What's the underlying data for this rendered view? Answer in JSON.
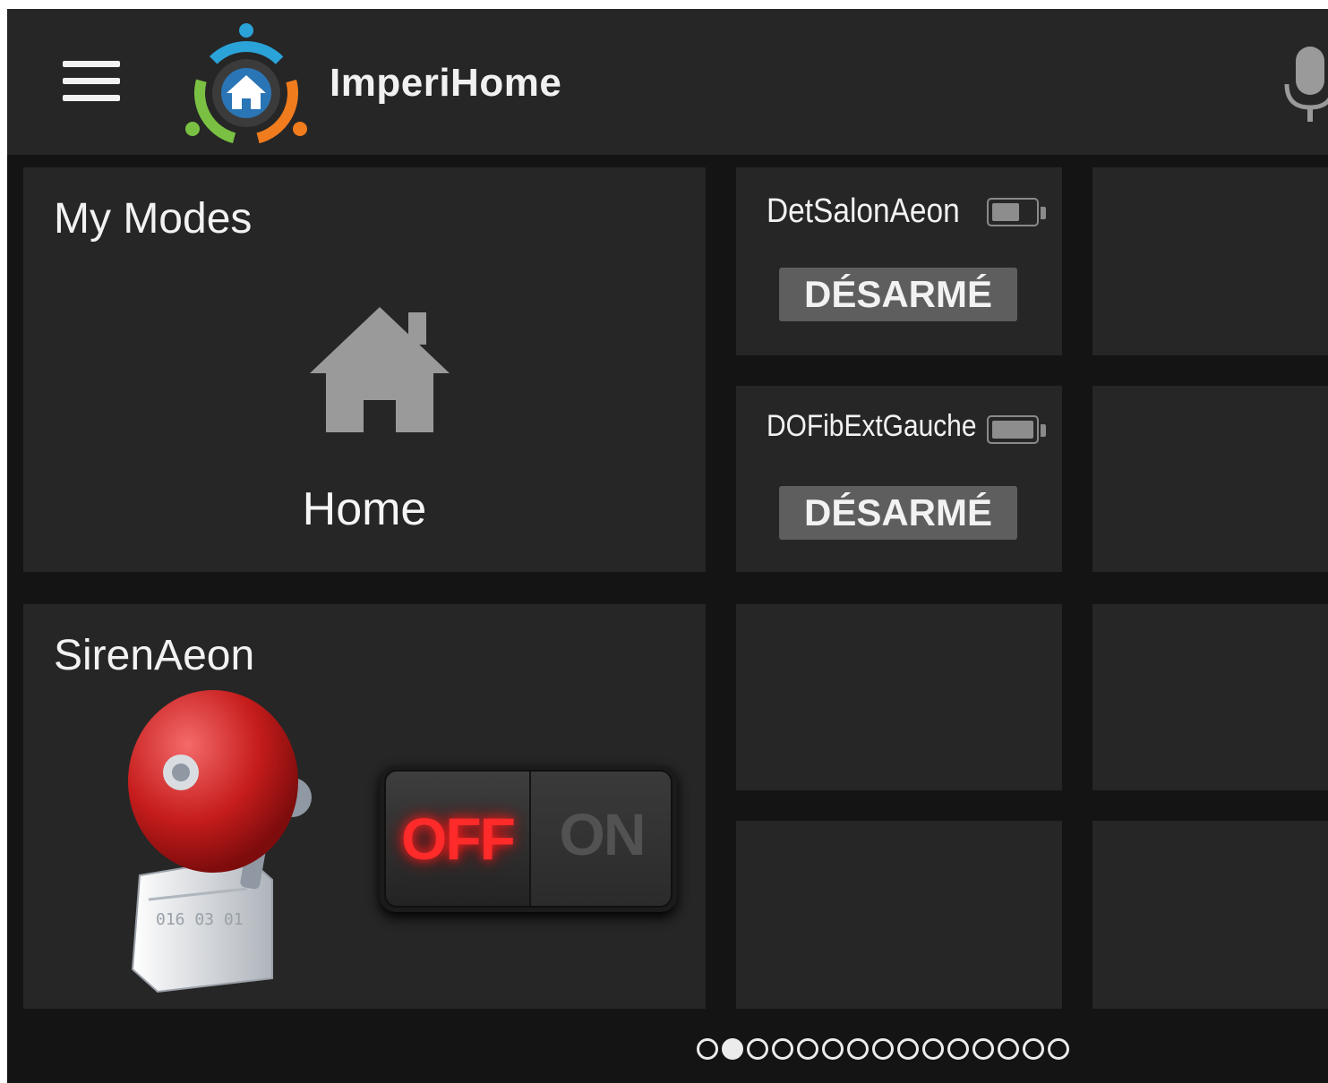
{
  "app": {
    "title": "ImperiHome",
    "icons": {
      "menu": "hamburger-menu-icon",
      "logo": "imperihome-logo-icon",
      "voice": "microphone-icon"
    }
  },
  "tiles": {
    "modes": {
      "title": "My Modes",
      "mode_label": "Home",
      "icon": "house-icon"
    },
    "sensor1": {
      "name": "DetSalonAeon",
      "state": "DÉSARMÉ",
      "battery_icon": "battery-icon"
    },
    "sensor2": {
      "name": "DOFibExtGauche",
      "state": "DÉSARMÉ",
      "battery_icon": "battery-icon"
    },
    "siren": {
      "title": "SirenAeon",
      "icon": "alarm-bell-icon",
      "switch_off_label": "OFF",
      "switch_on_label": "ON",
      "switch_state": "off"
    }
  },
  "pager": {
    "total": 15,
    "active": 2
  },
  "colors": {
    "background": "#141414",
    "tile": "#262626",
    "badge": "#5e5e5e",
    "switch_off_glow": "#ff2a2a"
  }
}
